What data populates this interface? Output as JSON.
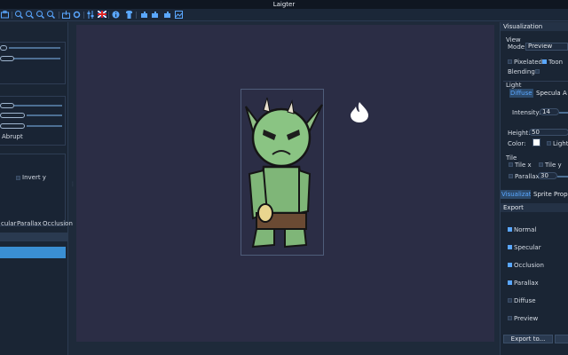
{
  "window": {
    "title": "Laigter"
  },
  "toolbar": {
    "icons": [
      "open-icon",
      "zoom-in-icon",
      "zoom-out-icon",
      "zoom-fit-icon",
      "zoom-reset-icon",
      "export-icon",
      "settings-icon",
      "language-flag-icon",
      "info-icon",
      "shirt-icon",
      "plugin-icon",
      "plugin-2-icon",
      "plugin-3-icon",
      "image-icon"
    ]
  },
  "left_panel": {
    "abrupt_label": "Abrupt",
    "invert_y_label": "Invert y",
    "tabs": [
      "cular",
      "Parallax",
      "Occlusion"
    ]
  },
  "right_panel": {
    "visualization_header": "Visualization",
    "view_label": "View",
    "mode_label": "Mode:",
    "mode_value": "Preview",
    "pixelated_label": "Pixelated",
    "toon_label": "Toon",
    "blending_label": "Blending:",
    "light_label": "Light",
    "light_tabs": [
      "Diffuse",
      "Specular",
      "A"
    ],
    "intensity_label": "Intensity:",
    "intensity_value": "14",
    "height_label": "Height:",
    "height_value": "50",
    "color_label": "Color:",
    "lighten_label": "Lighte",
    "tile_label": "Tile",
    "tile_x_label": "Tile x",
    "tile_y_label": "Tile y",
    "parallax_label": "Parallax",
    "parallax_value": "30",
    "bottom_tabs": [
      "Visualizat.",
      "Sprite Propert"
    ],
    "export_header": "Export",
    "export_items": [
      {
        "label": "Normal",
        "checked": true
      },
      {
        "label": "Specular",
        "checked": true
      },
      {
        "label": "Occlusion",
        "checked": true
      },
      {
        "label": "Parallax",
        "checked": true
      },
      {
        "label": "Diffuse",
        "checked": false
      },
      {
        "label": "Preview",
        "checked": false
      }
    ],
    "export_button": "Export to..."
  },
  "colors": {
    "accent": "#5aa7ff",
    "canvas": "#2b2d45",
    "panel": "#1a2534"
  }
}
